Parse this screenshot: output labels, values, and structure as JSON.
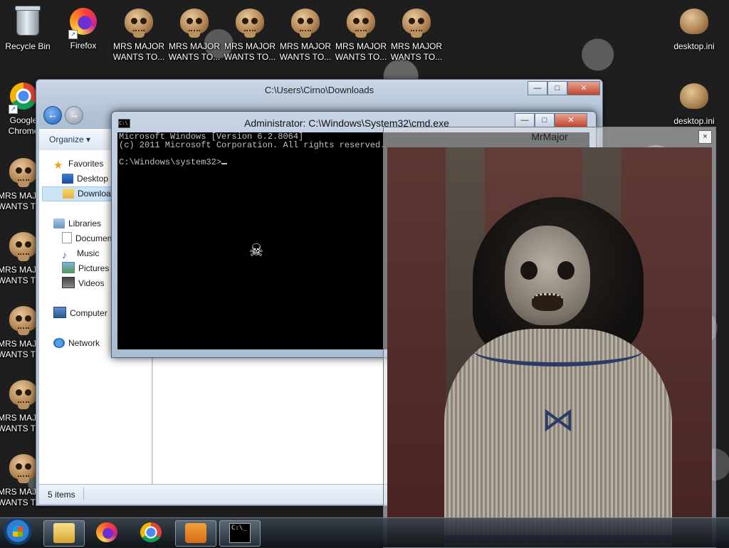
{
  "desktop": {
    "icons": [
      {
        "label": "Recycle Bin"
      },
      {
        "label": "Firefox"
      },
      {
        "label": "MRS MAJOR WANTS TO..."
      },
      {
        "label": "MRS MAJOR WANTS TO..."
      },
      {
        "label": "MRS MAJOR WANTS TO..."
      },
      {
        "label": "MRS MAJOR WANTS TO..."
      },
      {
        "label": "MRS MAJOR WANTS TO..."
      },
      {
        "label": "MRS MAJOR WANTS TO..."
      },
      {
        "label": "desktop.ini"
      },
      {
        "label": "Google Chrome"
      },
      {
        "label": "desktop.ini"
      },
      {
        "label": "MRS MAJOR WANTS TO..."
      },
      {
        "label": "MRS MAJOR WANTS TO..."
      },
      {
        "label": "MRS MAJOR WANTS TO..."
      },
      {
        "label": "MRS MAJOR WANTS TO..."
      },
      {
        "label": "MRS MAJOR WANTS TO..."
      }
    ]
  },
  "explorer": {
    "title": "C:\\Users\\Cirno\\Downloads",
    "organize_label": "Organize ▾",
    "nav": {
      "favorites": "Favorites",
      "desktop": "Desktop",
      "downloads": "Downloads",
      "libraries": "Libraries",
      "documents": "Documents",
      "music": "Music",
      "pictures": "Pictures",
      "videos": "Videos",
      "computer": "Computer",
      "network": "Network"
    },
    "status": "5 items"
  },
  "cmd": {
    "title": "Administrator: C:\\Windows\\System32\\cmd.exe",
    "lines": [
      "Microsoft Windows [Version 6.2.8064]",
      "(c) 2011 Microsoft Corporation. All rights reserved.",
      "",
      "C:\\Windows\\system32>"
    ]
  },
  "mrmajor": {
    "title": "MrMajor",
    "close": "×"
  },
  "window_buttons": {
    "min": "—",
    "max": "□",
    "close": "✕"
  }
}
